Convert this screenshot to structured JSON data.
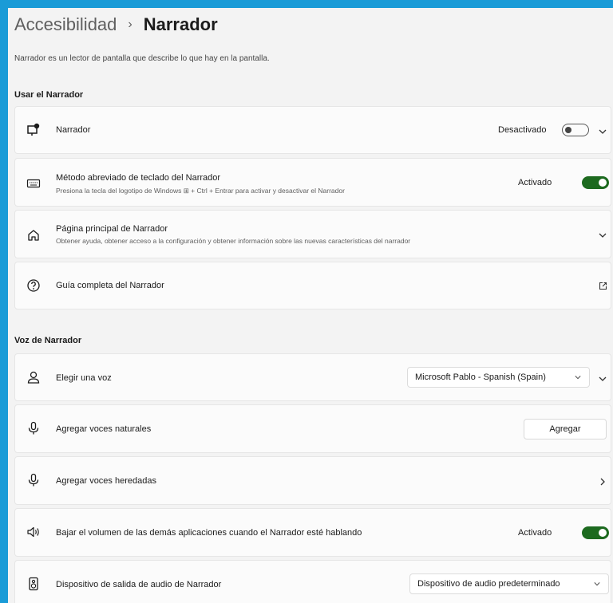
{
  "breadcrumb": {
    "parent": "Accesibilidad",
    "separator": "›",
    "current": "Narrador"
  },
  "description": "Narrador es un lector de pantalla que describe lo que hay en la pantalla.",
  "sections": {
    "use": "Usar el Narrador",
    "voice": "Voz de Narrador"
  },
  "rows": {
    "narrator": {
      "label": "Narrador",
      "state": "Desactivado",
      "toggle": "off"
    },
    "shortcut": {
      "label": "Método abreviado de teclado del Narrador",
      "sub": "Presiona la tecla del logotipo de Windows ⊞ + Ctrl + Entrar para activar y desactivar el Narrador",
      "state": "Activado",
      "toggle": "on"
    },
    "home": {
      "label": "Página principal de Narrador",
      "sub": "Obtener ayuda, obtener acceso a la configuración y obtener información sobre las nuevas características del narrador"
    },
    "guide": {
      "label": "Guía completa del Narrador"
    },
    "choose_voice": {
      "label": "Elegir una voz",
      "selected": "Microsoft Pablo - Spanish (Spain)"
    },
    "natural_voices": {
      "label": "Agregar voces naturales",
      "button": "Agregar"
    },
    "legacy_voices": {
      "label": "Agregar voces heredadas"
    },
    "lower_volume": {
      "label": "Bajar el volumen de las demás aplicaciones cuando el Narrador esté hablando",
      "state": "Activado",
      "toggle": "on"
    },
    "audio_output": {
      "label": "Dispositivo de salida de audio de Narrador",
      "selected": "Dispositivo de audio predeterminado"
    }
  },
  "colors": {
    "accent": "#1d6a1f",
    "frame": "#1a9bd7",
    "background": "#f3f3f3"
  }
}
